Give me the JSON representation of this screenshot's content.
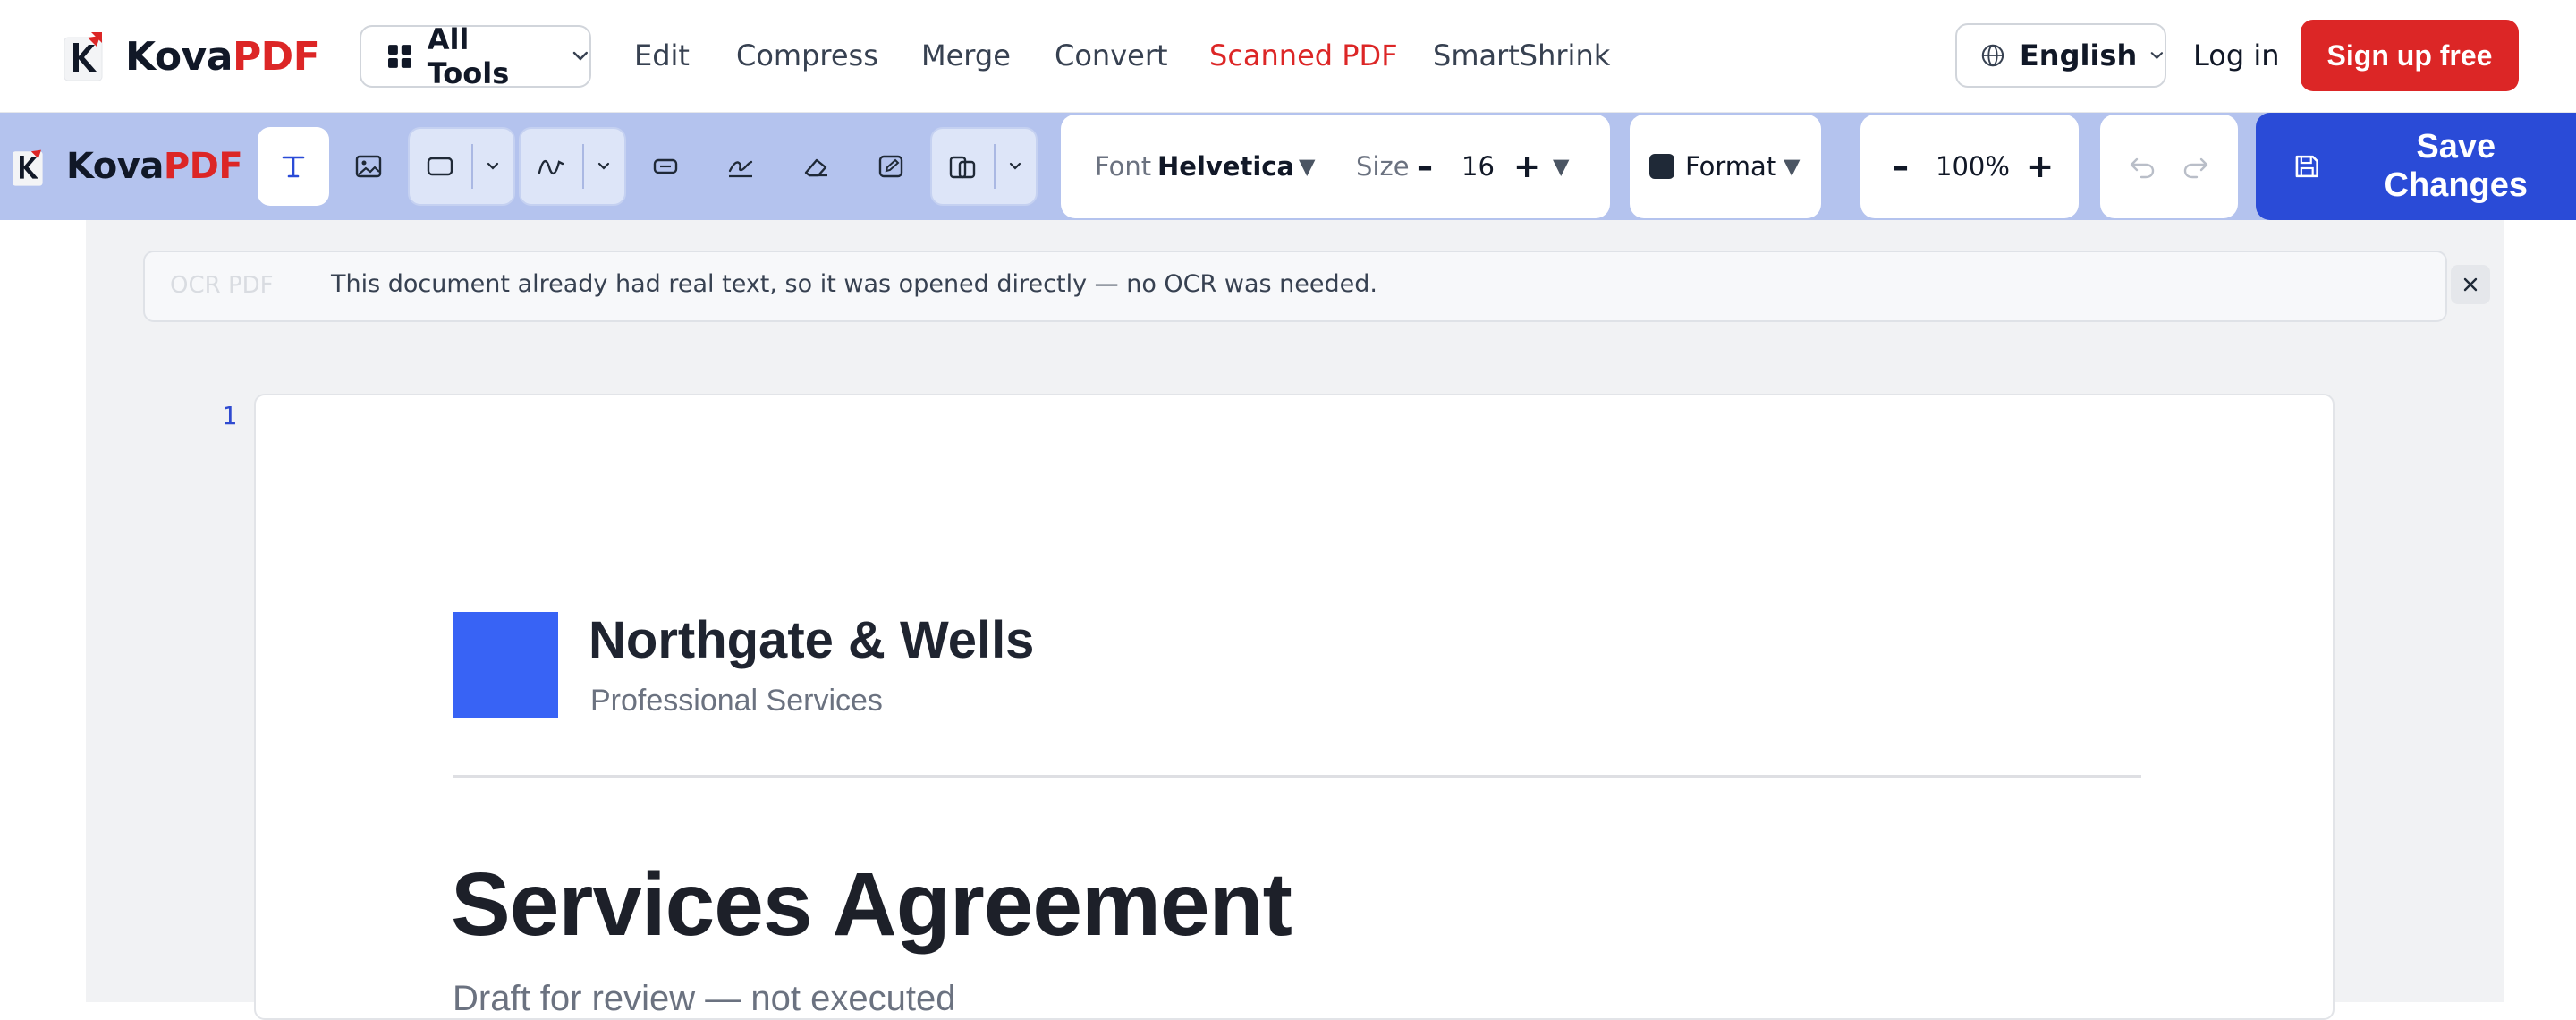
{
  "brand": {
    "name_part1": "Kova",
    "name_part2": "PDF",
    "accent": "#dc2626",
    "logo_icon": "kovapdf-logo"
  },
  "topnav": {
    "all_tools": "All Tools",
    "links": [
      {
        "label": "Edit",
        "active": false
      },
      {
        "label": "Compress",
        "active": false
      },
      {
        "label": "Merge",
        "active": false
      },
      {
        "label": "Convert",
        "active": false
      },
      {
        "label": "Scanned PDF",
        "active": true
      },
      {
        "label": "SmartShrink",
        "active": false
      }
    ],
    "language": "English",
    "login": "Log in",
    "signup": "Sign up free"
  },
  "toolbar": {
    "background": "#b4c3ee",
    "tools": [
      "text-tool-icon",
      "image-tool-icon",
      "shape-tool-icon",
      "draw-tool-icon",
      "form-field-icon",
      "signature-icon",
      "eraser-icon",
      "annotate-icon",
      "page-layout-icon"
    ],
    "font_label": "Font",
    "font_value": "Helvetica",
    "size_label": "Size",
    "size_minus": "–",
    "size_value": "16",
    "size_plus": "+",
    "format_label": "Format",
    "zoom_minus": "–",
    "zoom_value": "100%",
    "zoom_plus": "+",
    "save_label": "Save Changes",
    "save_color": "#2a4bd7"
  },
  "notice": {
    "ghost_text": "OCR PDF",
    "message": "This document already had real text, so it was opened directly — no OCR was needed.",
    "close_icon": "close-icon"
  },
  "document": {
    "page_number": "1",
    "company_name": "Northgate & Wells",
    "company_tagline": "Professional Services",
    "company_color": "#3863f5",
    "title": "Services Agreement",
    "subtitle": "Draft for review — not executed"
  }
}
